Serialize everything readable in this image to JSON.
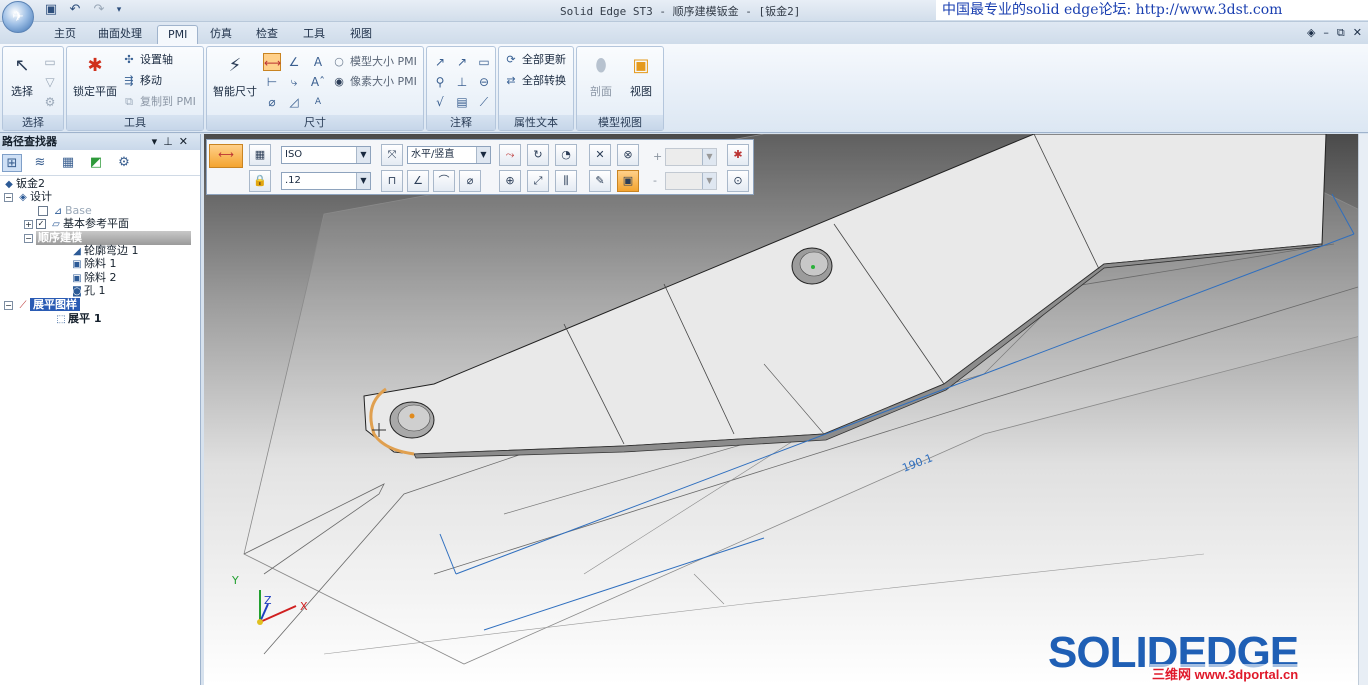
{
  "titlebar": {
    "title": "Solid Edge ST3 - 顺序建模钣金 - [钣金2]",
    "brand": "中国最专业的solid edge论坛:  http://www.3dst.com"
  },
  "tabs": [
    "主页",
    "曲面处理",
    "PMI",
    "仿真",
    "检查",
    "工具",
    "视图"
  ],
  "ribbon": {
    "select_group": {
      "label": "选择",
      "btn": "选择"
    },
    "tools_group": {
      "label": "工具",
      "lock_plane": "锁定平面",
      "set_axis": "设置轴",
      "move": "移动",
      "copy_to_pmi": "复制到 PMI"
    },
    "dim_group": {
      "label": "尺寸",
      "smart_dim": "智能尺寸",
      "model_size_pmi": "模型大小 PMI",
      "pixel_size_pmi": "像素大小 PMI"
    },
    "annotation_group": {
      "label": "注释"
    },
    "property_text_group": {
      "label": "属性文本",
      "update_all": "全部更新",
      "convert_all": "全部转换"
    },
    "model_view_group": {
      "label": "模型视图",
      "section": "剖面",
      "view": "视图"
    }
  },
  "finder": {
    "title": "路径查找器",
    "tree": {
      "root": "钣金2",
      "design": "设计",
      "base": "Base",
      "base_ref_planes": "基本参考平面",
      "ordered_modeling": "顺序建模",
      "contour_flange": "轮廓弯边 1",
      "cut1": "除料 1",
      "cut2": "除料 2",
      "hole": "孔 1",
      "flat_pattern": "展平图样",
      "flatten": "展平 1"
    }
  },
  "command_bar": {
    "standard": "ISO",
    "orientation": "水平/竖直",
    "precision": ".12",
    "plus": "+",
    "minus": "-"
  },
  "viewport": {
    "dimension_value": "190.1",
    "axis_x": "X",
    "axis_y": "Y",
    "axis_z": "Z"
  },
  "watermark": {
    "logo": "SOLIDEDGE",
    "portal": "三维网 www.3dportal.cn"
  },
  "colors": {
    "accent": "#2a5bb4",
    "dimension": "#2f6fbf",
    "highlight_orange": "#f4a430"
  }
}
